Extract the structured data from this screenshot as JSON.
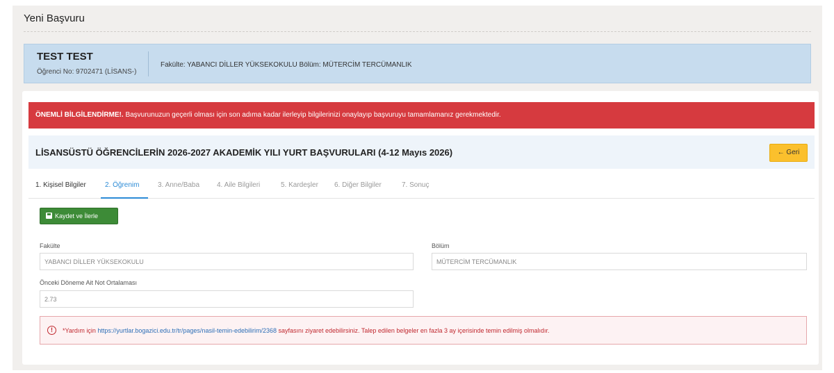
{
  "page": {
    "title": "Yeni Başvuru"
  },
  "student": {
    "name": "TEST TEST",
    "student_no": "Öğrenci No: 9702471 (LİSANS-)",
    "faculty_dept": "Fakülte: YABANCI DİLLER YÜKSEKOKULU   Bölüm: MÜTERCİM TERCÜMANLIK"
  },
  "alert": {
    "strong": "ÖNEMLİ BİLGİLENDİRME!.",
    "text": " Başvurunuzun geçerli olması için son adıma kadar ilerleyip bilgilerinizi onaylayıp başvuruyu tamamlamanız gerekmektedir."
  },
  "header": {
    "title": "LİSANSÜSTÜ ÖĞRENCİLERİN 2026-2027 AKADEMİK YILI YURT BAŞVURULARI (4-12 Mayıs 2026)",
    "back_label": "← Geri"
  },
  "tabs": [
    {
      "label": "1. Kişisel Bilgiler",
      "state": "done"
    },
    {
      "label": "2. Öğrenim",
      "state": "active"
    },
    {
      "label": "3. Anne/Baba",
      "state": "disabled"
    },
    {
      "label": "4. Aile Bilgileri",
      "state": "disabled"
    },
    {
      "label": "5. Kardeşler",
      "state": "disabled"
    },
    {
      "label": "6. Diğer Bilgiler",
      "state": "disabled"
    },
    {
      "label": "7. Sonuç",
      "state": "disabled"
    }
  ],
  "form": {
    "save_label": "Kaydet ve İlerle",
    "faculty_label": "Fakülte",
    "faculty_value": "YABANCI DİLLER YÜKSEKOKULU",
    "dept_label": "Bölüm",
    "dept_value": "MÜTERCİM TERCÜMANLIK",
    "gpa_label": "Önceki Döneme Ait Not Ortalaması",
    "gpa_value": "2.73"
  },
  "help": {
    "prefix": "*Yardım için ",
    "link": "https://yurtlar.bogazici.edu.tr/tr/pages/nasil-temin-edebilirim/2368",
    "suffix": " sayfasını ziyaret edebilirsiniz. Talep edilen belgeler en fazla 3 ay içerisinde temin edilmiş olmalıdır."
  },
  "colors": {
    "accent": "#2c8bd6",
    "danger": "#d63a3f",
    "save_button": "#3d8b37",
    "back_button": "#fbc02d",
    "student_bar": "#c7dcee"
  },
  "icons": {
    "save": "floppy-disk-icon",
    "warning": "exclamation-circle-icon",
    "back": "arrow-left-icon"
  }
}
